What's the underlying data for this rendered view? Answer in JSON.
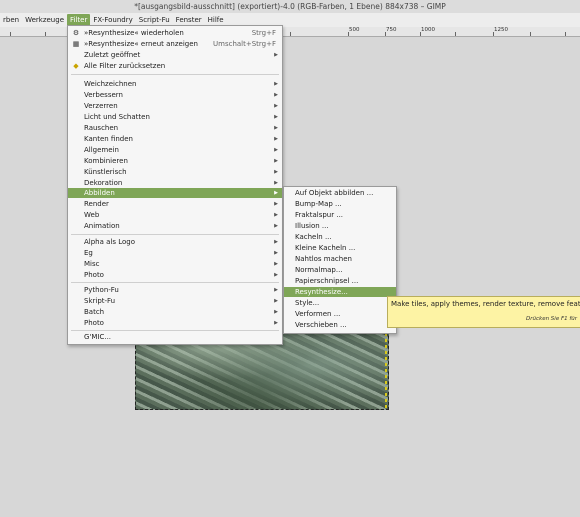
{
  "window": {
    "title": "*[ausgangsbild-ausschnitt] (exportiert)-4.0 (RGB-Farben, 1 Ebene) 884x738 – GIMP"
  },
  "menubar": {
    "items": [
      "rben",
      "Werkzeuge",
      "Filter",
      "FX-Foundry",
      "Script-Fu",
      "Fenster",
      "Hilfe"
    ]
  },
  "ruler": {
    "labels": [
      "500",
      "750",
      "1000",
      "1250"
    ]
  },
  "filter_menu": {
    "repeat": {
      "label": "»Resynthesize« wiederholen",
      "shortcut": "Strg+F"
    },
    "reshow": {
      "label": "»Resynthesize« erneut anzeigen",
      "shortcut": "Umschalt+Strg+F"
    },
    "recent": {
      "label": "Zuletzt geöffnet"
    },
    "reset": {
      "label": "Alle Filter zurücksetzen"
    },
    "group1": [
      "Weichzeichnen",
      "Verbessern",
      "Verzerren",
      "Licht und Schatten",
      "Rauschen",
      "Kanten finden",
      "Allgemein",
      "Kombinieren",
      "Künstlerisch",
      "Dekoration",
      "Abbilden",
      "Render",
      "Web",
      "Animation"
    ],
    "group2": [
      "Alpha als Logo",
      "Eg",
      "Misc",
      "Photo"
    ],
    "group3": [
      "Python-Fu",
      "Skript-Fu",
      "Batch",
      "Photo"
    ],
    "gmic": "G'MIC..."
  },
  "abbilden_submenu": {
    "items": [
      "Auf Objekt abbilden ...",
      "Bump-Map ...",
      "Fraktalspur ...",
      "Illusion ...",
      "Kacheln ...",
      "Kleine Kacheln ...",
      "Nahtlos machen",
      "Normalmap...",
      "Papierschnipsel ...",
      "Resynthesize...",
      "Style...",
      "Verformen ...",
      "Verschieben ..."
    ]
  },
  "tooltip": {
    "text": "Make tiles, apply themes, render texture, remove featu",
    "help": "Drücken Sie F1 für"
  },
  "colors": {
    "highlight": "#7fa657",
    "tooltip_bg": "#fdf3a4"
  }
}
